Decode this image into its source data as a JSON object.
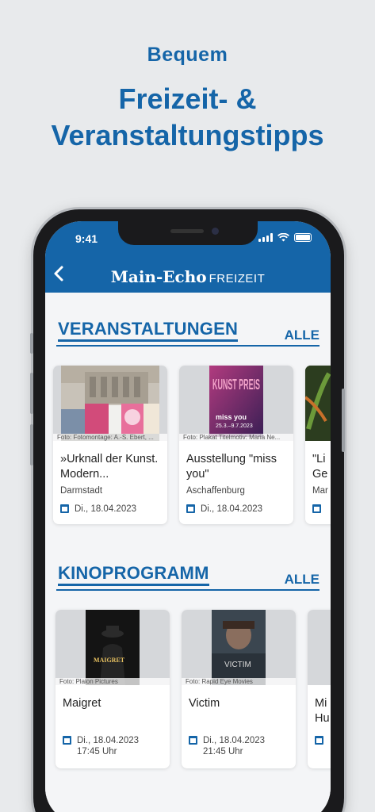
{
  "promo": {
    "subtitle": "Bequem",
    "title_line1": "Freizeit- &",
    "title_line2": "Veranstaltungstipps"
  },
  "status": {
    "time": "9:41"
  },
  "header": {
    "brand_main": "Main-Echo",
    "brand_sub": "FREIZEIT",
    "back_icon": "chevron-left-icon"
  },
  "events": {
    "title": "VERANSTALTUNGEN",
    "all_label": "ALLE",
    "items": [
      {
        "credit": "Foto: Fotomontage: A.-S. Ebert, ...",
        "title": "»Urknall der Kunst. Modern...",
        "location": "Darmstadt",
        "date": "Di., 18.04.2023"
      },
      {
        "credit": "Foto: Plakat Titelmotiv: Maria Ne...",
        "title": "Ausstellung \"miss you\"",
        "location": "Aschaffenburg",
        "date": "Di., 18.04.2023"
      },
      {
        "title_line1": "\"Li",
        "title_line2": "Ge",
        "location": "Mar"
      }
    ]
  },
  "cinema": {
    "title": "KINOPROGRAMM",
    "all_label": "ALLE",
    "items": [
      {
        "credit": "Foto: Plaion Pictures",
        "title": "Maigret",
        "date": "Di., 18.04.2023",
        "time": "17:45 Uhr"
      },
      {
        "credit": "Foto: Rapid Eye Movies",
        "title": "Victim",
        "date": "Di., 18.04.2023",
        "time": "21:45 Uhr"
      },
      {
        "title_line1": "Mi",
        "title_line2": "Hu"
      }
    ]
  },
  "poster_text": {
    "kunstpreis": "KUNST PREIS",
    "miss_you": "miss you",
    "dates": "25.3.–9.7.2023",
    "maigret": "MAIGRET",
    "victim": "VICTIM"
  },
  "colors": {
    "brand_blue": "#1565a8",
    "background": "#e8eaec"
  }
}
